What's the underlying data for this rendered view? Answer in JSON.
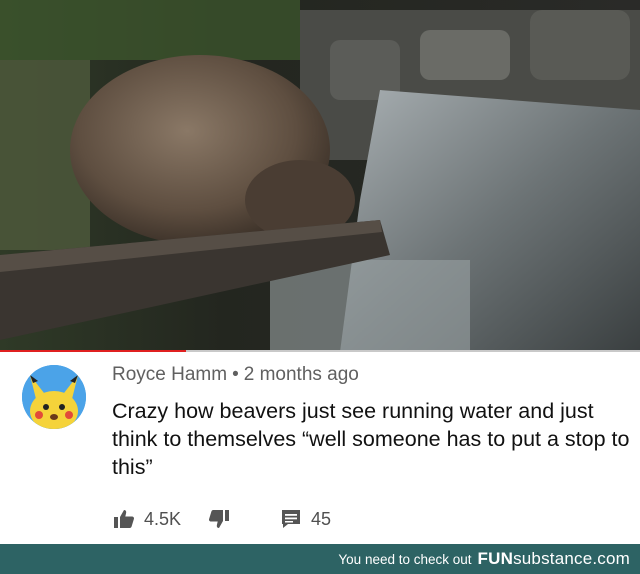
{
  "video": {
    "description_icon": "beaver-scene",
    "progress_fraction": 0.29
  },
  "comment": {
    "author": "Royce Hamm",
    "separator": "•",
    "time": "2 months ago",
    "text": "Crazy how beavers just see running water and just think to themselves “well someone has to put a stop to this”",
    "likes": "4.5K",
    "replies": "45",
    "avatar_icon": "pikachu-avatar"
  },
  "footer": {
    "tagline": "You need to check out",
    "brand_bold": "FUN",
    "brand_rest": "substance.com"
  },
  "colors": {
    "progress": "#e02020",
    "footer_bg": "#2d6364"
  }
}
